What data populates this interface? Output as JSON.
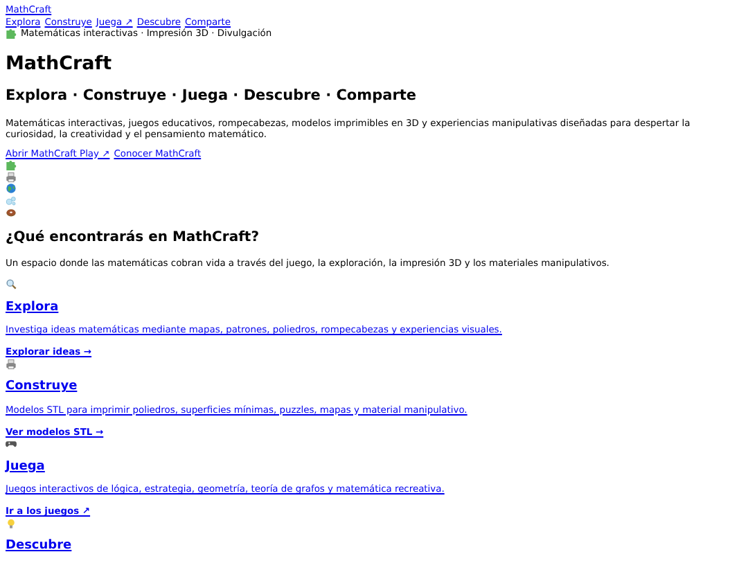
{
  "site_link": "MathCraft",
  "nav": [
    "Explora",
    "Construye",
    "Juega ↗",
    "Descubre",
    "Comparte"
  ],
  "tagline": "Matemáticas interactivas · Impresión 3D · Divulgación",
  "title": "MathCraft",
  "subtitle": "Explora · Construye · Juega · Descubre · Comparte",
  "intro": "Matemáticas interactivas, juegos educativos, rompecabezas, modelos imprimibles en 3D y experiencias manipulativas diseñadas para despertar la curiosidad, la creatividad y el pensamiento matemático.",
  "cta_links": [
    "Abrir MathCraft Play ↗",
    "Conocer MathCraft"
  ],
  "section_title": "¿Qué encontrarás en MathCraft?",
  "section_text": "Un espacio donde las matemáticas cobran vida a través del juego, la exploración, la impresión 3D y los materiales manipulativos.",
  "cards": [
    {
      "title": "Explora",
      "description": "Investiga ideas matemáticas mediante mapas, patrones, poliedros, rompecabezas y experiencias visuales.",
      "link": "Explorar ideas →"
    },
    {
      "title": "Construye",
      "description": "Modelos STL para imprimir poliedros, superficies mínimas, puzzles, mapas y material manipulativo.",
      "link": "Ver modelos STL →"
    },
    {
      "title": "Juega",
      "description": "Juegos interactivos de lógica, estrategia, geometría, teoría de grafos y matemática recreativa.",
      "link": "Ir a los juegos ↗"
    },
    {
      "title": "Descubre"
    }
  ]
}
